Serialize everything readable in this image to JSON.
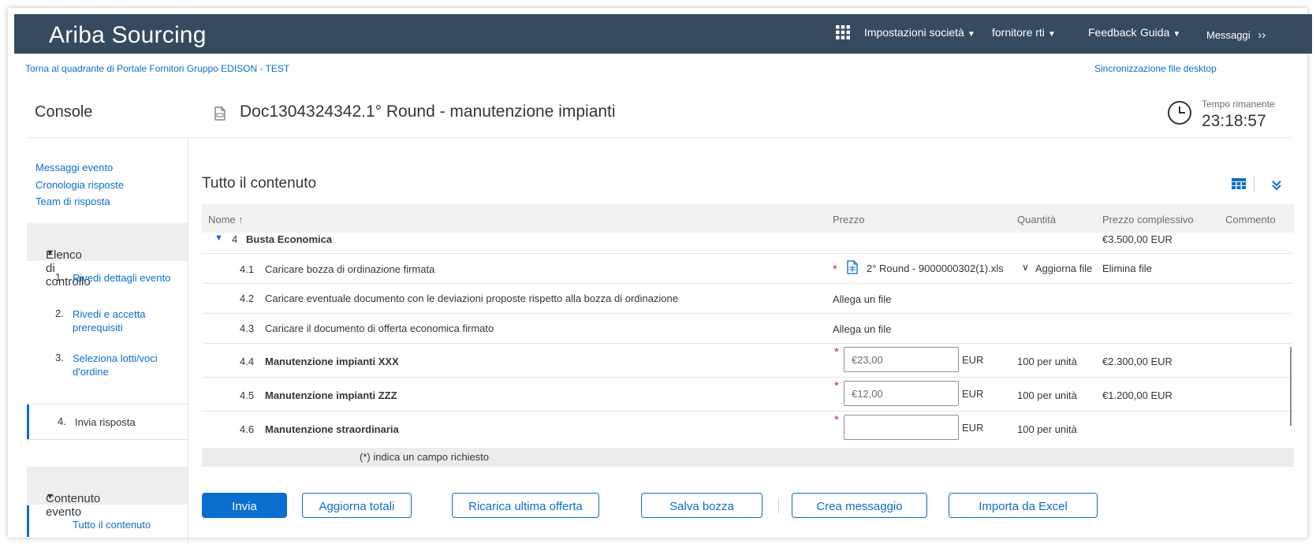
{
  "header": {
    "brand": "Ariba Sourcing",
    "menu": {
      "company_settings": "Impostazioni società",
      "supplier": "fornitore rti",
      "feedback": "Feedback",
      "help": "Guida",
      "messages": "Messaggi"
    }
  },
  "subbar": {
    "back_link": "Torna al quadrante di Portale Fornitori Gruppo EDISON - TEST",
    "sync_link": "Sincronizzazione file desktop"
  },
  "console_title": "Console",
  "doc_title": "Doc1304324342.1° Round - manutenzione impianti",
  "timer": {
    "label": "Tempo rimanente",
    "value": "23:18:57"
  },
  "sidebar": {
    "links": [
      "Messaggi evento",
      "Cronologia risposte",
      "Team di risposta"
    ],
    "checklist_title": "Elenco di controllo",
    "checklist": [
      {
        "num": "1.",
        "label": "Rivedi dettagli evento"
      },
      {
        "num": "2.",
        "label": "Rivedi e accetta prerequisiti"
      },
      {
        "num": "3.",
        "label": "Seleziona lotti/voci d'ordine"
      },
      {
        "num": "4.",
        "label": "Invia risposta"
      }
    ],
    "content_title": "Contenuto evento",
    "content_items": [
      "Tutto il contenuto"
    ]
  },
  "main": {
    "title": "Tutto il contenuto",
    "columns": {
      "name": "Nome ↑",
      "price": "Prezzo",
      "quantity": "Quantità",
      "total": "Prezzo complessivo",
      "comment": "Commento"
    },
    "section": {
      "num": "4",
      "name": "Busta Economica",
      "total": "€3.500,00 EUR"
    },
    "rows": [
      {
        "num": "4.1",
        "name": "Caricare bozza di ordinazione firmata",
        "file_name": "2° Round - 9000000302(1).xls",
        "update_file": "Aggiorna file",
        "delete_file": "Elimina file"
      },
      {
        "num": "4.2",
        "name": "Caricare eventuale documento con le deviazioni proposte rispetto alla bozza di ordinazione",
        "attach": "Allega un file"
      },
      {
        "num": "4.3",
        "name": "Caricare il documento di offerta economica firmato",
        "attach": "Allega un file"
      },
      {
        "num": "4.4",
        "name": "Manutenzione impianti XXX",
        "price": "€23,00",
        "currency": "EUR",
        "quantity": "100 per unità",
        "total": "€2.300,00 EUR"
      },
      {
        "num": "4.5",
        "name": "Manutenzione impianti ZZZ",
        "price": "€12,00",
        "currency": "EUR",
        "quantity": "100 per unità",
        "total": "€1.200,00 EUR"
      },
      {
        "num": "4.6",
        "name": "Manutenzione straordinaria",
        "price": "",
        "currency": "EUR",
        "quantity": "100 per unità",
        "total": ""
      }
    ],
    "required_note": "(*) indica un campo richiesto",
    "required_mark": "*"
  },
  "buttons": {
    "submit": "Invia",
    "update_totals": "Aggiorna totali",
    "reload_last": "Ricarica ultima offerta",
    "save_draft": "Salva bozza",
    "create_message": "Crea messaggio",
    "import_excel": "Importa da Excel"
  },
  "colors": {
    "header_bg": "#354a5f",
    "accent": "#0a6ed1",
    "required": "#d0271d"
  }
}
